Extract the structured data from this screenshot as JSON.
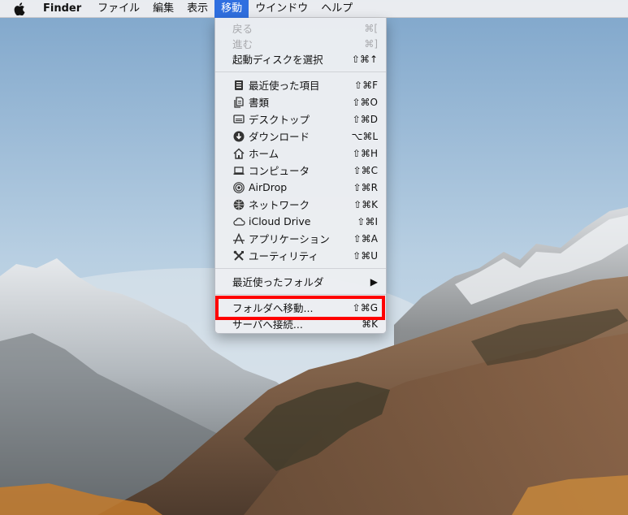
{
  "menubar": {
    "app_name": "Finder",
    "items": [
      "ファイル",
      "編集",
      "表示",
      "移動",
      "ウインドウ",
      "ヘルプ"
    ],
    "active_item": "移動"
  },
  "menu": {
    "items": [
      {
        "label": "戻る",
        "shortcut": "⌘[",
        "disabled": true
      },
      {
        "label": "進む",
        "shortcut": "⌘]",
        "disabled": true
      },
      {
        "label": "起動ディスクを選択",
        "shortcut": "⇧⌘↑"
      },
      {
        "label": "最近使った項目",
        "shortcut": "⇧⌘F",
        "icon": "recents-icon"
      },
      {
        "label": "書類",
        "shortcut": "⇧⌘O",
        "icon": "documents-icon"
      },
      {
        "label": "デスクトップ",
        "shortcut": "⇧⌘D",
        "icon": "desktop-icon"
      },
      {
        "label": "ダウンロード",
        "shortcut": "⌥⌘L",
        "icon": "downloads-icon"
      },
      {
        "label": "ホーム",
        "shortcut": "⇧⌘H",
        "icon": "home-icon"
      },
      {
        "label": "コンピュータ",
        "shortcut": "⇧⌘C",
        "icon": "computer-icon"
      },
      {
        "label": "AirDrop",
        "shortcut": "⇧⌘R",
        "icon": "airdrop-icon"
      },
      {
        "label": "ネットワーク",
        "shortcut": "⇧⌘K",
        "icon": "network-icon"
      },
      {
        "label": "iCloud Drive",
        "shortcut": "⇧⌘I",
        "icon": "icloud-icon"
      },
      {
        "label": "アプリケーション",
        "shortcut": "⇧⌘A",
        "icon": "applications-icon"
      },
      {
        "label": "ユーティリティ",
        "shortcut": "⇧⌘U",
        "icon": "utilities-icon"
      },
      {
        "label": "最近使ったフォルダ",
        "submenu_arrow": "▶"
      },
      {
        "label": "フォルダへ移動...",
        "shortcut": "⇧⌘G",
        "highlighted": true
      },
      {
        "label": "サーバへ接続...",
        "shortcut": "⌘K"
      }
    ]
  },
  "colors": {
    "menubar_active": "#2f6fe0",
    "highlight_box": "#ff0000"
  }
}
